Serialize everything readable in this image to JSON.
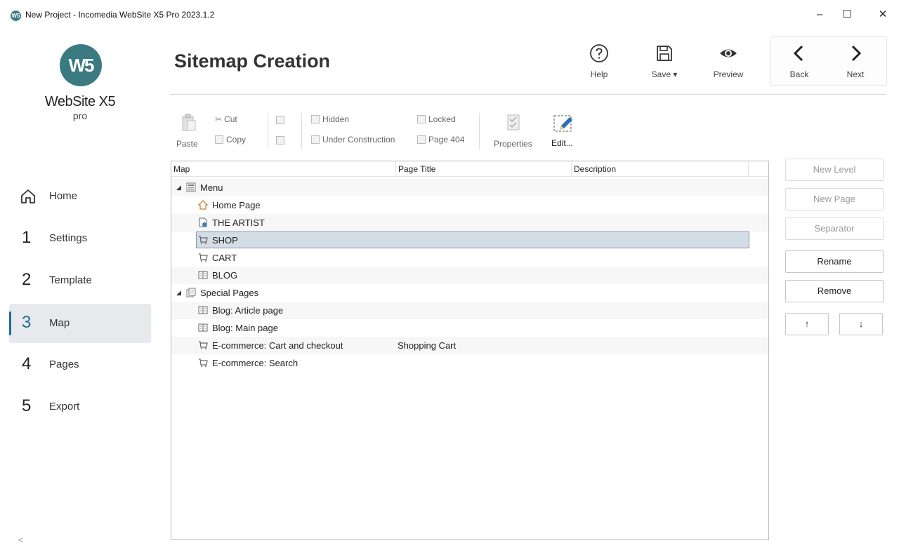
{
  "window": {
    "title": "New Project - Incomedia WebSite X5 Pro 2023.1.2",
    "app_icon_text": "W5",
    "minimize": "–",
    "maximize": "☐",
    "close": "✕"
  },
  "logo": {
    "badge": "W5",
    "name": "WebSite X5",
    "edition": "pro"
  },
  "nav": {
    "home": "Home",
    "items": [
      {
        "num": "1",
        "label": "Settings"
      },
      {
        "num": "2",
        "label": "Template"
      },
      {
        "num": "3",
        "label": "Map"
      },
      {
        "num": "4",
        "label": "Pages"
      },
      {
        "num": "5",
        "label": "Export"
      }
    ],
    "active": "Map",
    "collapse": "<"
  },
  "header": {
    "title": "Sitemap Creation",
    "help": "Help",
    "save": "Save ▾",
    "preview": "Preview",
    "back": "Back",
    "next": "Next"
  },
  "toolbar": {
    "paste": "Paste",
    "cut": "Cut",
    "copy": "Copy",
    "hidden": "Hidden",
    "under_construction": "Under Construction",
    "locked": "Locked",
    "page404": "Page 404",
    "properties": "Properties",
    "edit": "Edit..."
  },
  "grid": {
    "columns": [
      "Map",
      "Page Title",
      "Description"
    ],
    "rows": [
      {
        "name": "Menu",
        "title": "",
        "icon": "menu-folder-icon",
        "level": 0,
        "expanded": true
      },
      {
        "name": "Home Page",
        "title": "",
        "icon": "home-icon",
        "level": 1
      },
      {
        "name": "THE ARTIST",
        "title": "",
        "icon": "page-icon",
        "level": 1
      },
      {
        "name": "SHOP",
        "title": "",
        "icon": "cart-icon",
        "level": 1,
        "selected": true
      },
      {
        "name": "CART",
        "title": "",
        "icon": "cart-icon",
        "level": 1
      },
      {
        "name": "BLOG",
        "title": "",
        "icon": "blog-icon",
        "level": 1
      },
      {
        "name": "Special Pages",
        "title": "",
        "icon": "special-pages-icon",
        "level": 0,
        "expanded": true
      },
      {
        "name": "Blog: Article page",
        "title": "",
        "icon": "blog-icon",
        "level": 1
      },
      {
        "name": "Blog: Main page",
        "title": "",
        "icon": "blog-icon",
        "level": 1
      },
      {
        "name": "E-commerce: Cart and checkout",
        "title": "Shopping Cart",
        "icon": "cart-icon",
        "level": 1
      },
      {
        "name": "E-commerce: Search",
        "title": "",
        "icon": "cart-icon",
        "level": 1
      }
    ]
  },
  "actions": {
    "new_level": "New Level",
    "new_page": "New Page",
    "separator": "Separator",
    "rename": "Rename",
    "remove": "Remove",
    "up": "↑",
    "down": "↓"
  },
  "colors": {
    "accent": "#1e6f8a",
    "logo": "#3b7a80",
    "selection": "#d4dde6"
  }
}
